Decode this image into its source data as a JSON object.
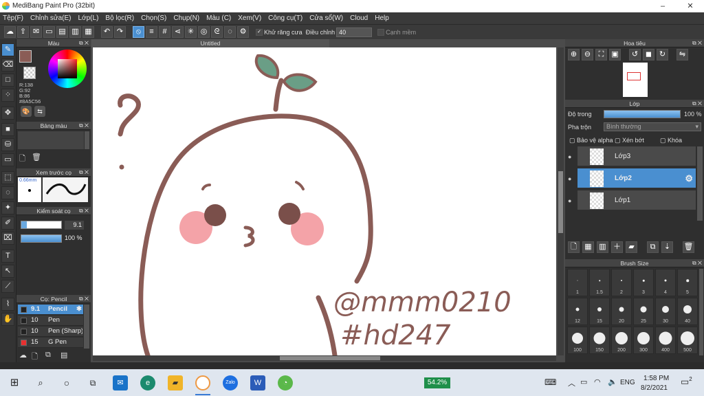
{
  "window": {
    "title": "MediBang Paint Pro (32bit)",
    "minimize": "–",
    "restore": "❐",
    "close": "✕"
  },
  "menu": [
    "Tệp(F)",
    "Chỉnh sửa(E)",
    "Lớp(L)",
    "Bộ lọc(R)",
    "Chọn(S)",
    "Chụp(N)",
    "Màu (C)",
    "Xem(V)",
    "Công cụ(T)",
    "Cửa sổ(W)",
    "Cloud",
    "Help"
  ],
  "toolbar": {
    "antialias_label": "Khử răng cưa",
    "adjust_label": "Điều chỉnh",
    "adjust_value": "40",
    "edge_label": "Cạnh mềm"
  },
  "color_panel": {
    "title": "Màu",
    "r": "R:138",
    "g": "G:92",
    "b": "B:86",
    "hex": "#8A5C56",
    "primary": "#8a5c56"
  },
  "palette_panel": {
    "title": "Bảng màu"
  },
  "preview_panel": {
    "title": "Xem trước cọ",
    "size": "0.66mm"
  },
  "control_panel": {
    "title": "Kiểm soát cọ",
    "size_value": "9.1",
    "opacity_value": "100 %"
  },
  "brush_panel": {
    "title": "Cọ: Pencil",
    "items": [
      {
        "size": "9.1",
        "name": "Pencil",
        "color": "#222222",
        "selected": true
      },
      {
        "size": "10",
        "name": "Pen",
        "color": "#222222",
        "selected": false
      },
      {
        "size": "10",
        "name": "Pen (Sharp)",
        "color": "#222222",
        "selected": false
      },
      {
        "size": "15",
        "name": "G Pen",
        "color": "#e83030",
        "selected": false
      }
    ]
  },
  "document": {
    "tab": "Untitled"
  },
  "canvas": {
    "signature_line1": "@mmm0210",
    "signature_line2": "#hd247"
  },
  "navigator": {
    "title": "Hoa tiêu"
  },
  "layer_panel": {
    "title": "Lớp",
    "opacity_label": "Độ trong",
    "opacity_value": "100 %",
    "opacity_fraction": 1.0,
    "blend_label": "Pha trộn",
    "blend_value": "Bình thường",
    "protect_alpha": "Bảo vệ alpha",
    "clipping": "Xén bớt",
    "lock": "Khóa",
    "layers": [
      {
        "name": "Lớp3",
        "selected": false
      },
      {
        "name": "Lớp2",
        "selected": true
      },
      {
        "name": "Lớp1",
        "selected": false
      }
    ]
  },
  "brush_size_panel": {
    "title": "Brush Size",
    "sizes": [
      "1",
      "1.5",
      "2",
      "3",
      "4",
      "5",
      "12",
      "15",
      "20",
      "25",
      "30",
      "40",
      "100",
      "150",
      "200",
      "300",
      "400",
      "500"
    ]
  },
  "taskbar": {
    "battery": "54.2%",
    "language": "ENG",
    "time": "1:58 PM",
    "date": "8/2/2021",
    "notifications": "2"
  }
}
